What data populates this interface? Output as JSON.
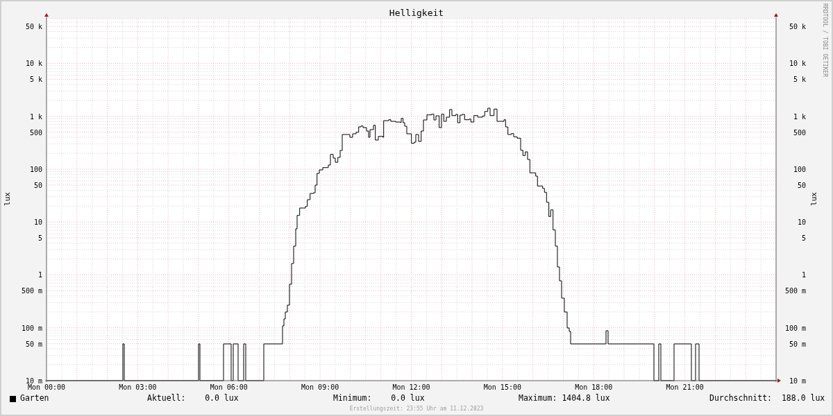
{
  "chart": {
    "title": "Helligkeit",
    "credit": "RRDTOOL / TOBI OETIKER",
    "y_axis_left": {
      "label": "lux",
      "ticks": [
        "50 k",
        "10 k",
        "5 k",
        "1 k",
        "500",
        "100",
        "50",
        "10",
        "5",
        "1",
        "500 m",
        "100 m",
        "50 m",
        "10 m"
      ]
    },
    "y_axis_right": {
      "label": "lux",
      "ticks": [
        "50 k",
        "10 k",
        "5 k",
        "1 k",
        "500",
        "100",
        "50",
        "10",
        "5",
        "1",
        "500 m",
        "100 m",
        "50 m",
        "10 m"
      ]
    },
    "x_axis": {
      "ticks": [
        "Mon 00:00",
        "Mon 03:00",
        "Mon 06:00",
        "Mon 09:00",
        "Mon 12:00",
        "Mon 15:00",
        "Mon 18:00",
        "Mon 21:00"
      ]
    }
  },
  "legend": {
    "series": "Garten",
    "stats": [
      {
        "label": "Aktuell:",
        "value": "0.0 lux"
      },
      {
        "label": "Minimum:",
        "value": "0.0 lux"
      },
      {
        "label": "Maximum:",
        "value": "1404.8 lux"
      },
      {
        "label": "Durchschnitt:",
        "value": "188.0 lux"
      }
    ]
  },
  "footer": "Erstellungszeit: 23:55 Uhr am 11.12.2023"
}
